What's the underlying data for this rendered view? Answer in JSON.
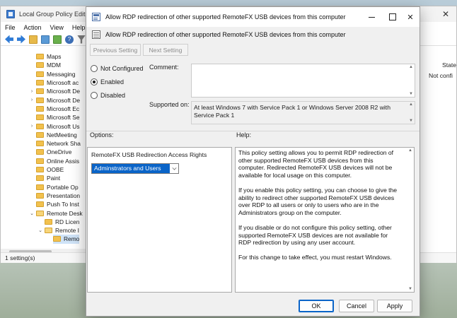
{
  "background_window": {
    "title": "Local Group Policy Editor",
    "menu": [
      "File",
      "Action",
      "View",
      "Help"
    ],
    "tree": [
      {
        "label": "Maps",
        "indent": 2
      },
      {
        "label": "MDM",
        "indent": 2
      },
      {
        "label": "Messaging",
        "indent": 2
      },
      {
        "label": "Microsoft ac",
        "indent": 2
      },
      {
        "label": "Microsoft De",
        "indent": 2,
        "chev": "›"
      },
      {
        "label": "Microsoft De",
        "indent": 2,
        "chev": "›"
      },
      {
        "label": "Microsoft Ec",
        "indent": 2
      },
      {
        "label": "Microsoft Se",
        "indent": 2
      },
      {
        "label": "Microsoft Us",
        "indent": 2,
        "chev": "›"
      },
      {
        "label": "NetMeeting",
        "indent": 2
      },
      {
        "label": "Network Sha",
        "indent": 2
      },
      {
        "label": "OneDrive",
        "indent": 2
      },
      {
        "label": "Online Assis",
        "indent": 2
      },
      {
        "label": "OOBE",
        "indent": 2
      },
      {
        "label": "Paint",
        "indent": 2
      },
      {
        "label": "Portable Op",
        "indent": 2
      },
      {
        "label": "Presentation",
        "indent": 2
      },
      {
        "label": "Push To Inst",
        "indent": 2
      },
      {
        "label": "Remote Desk",
        "indent": 2,
        "chev": "⌄"
      },
      {
        "label": "RD Licen",
        "indent": 3
      },
      {
        "label": "Remote I",
        "indent": 3,
        "chev": "⌄"
      },
      {
        "label": "Remo",
        "indent": 4,
        "selected": true
      }
    ],
    "column_header": "State",
    "column_value": "Not confi",
    "status": "1 setting(s)"
  },
  "dialog": {
    "title": "Allow RDP redirection of other supported RemoteFX USB devices from this computer",
    "header": "Allow RDP redirection of other supported RemoteFX USB devices from this computer",
    "previous_setting": "Previous Setting",
    "next_setting": "Next Setting",
    "radios": {
      "not_configured": "Not Configured",
      "enabled": "Enabled",
      "disabled": "Disabled"
    },
    "selected_option": "Enabled",
    "comment_label": "Comment:",
    "comment_value": "",
    "supported_label": "Supported on:",
    "supported_value": "At least Windows 7 with Service Pack 1 or Windows Server 2008 R2 with Service Pack 1",
    "options_label": "Options:",
    "help_label": "Help:",
    "option_title": "RemoteFX USB Redirection Access Rights",
    "option_select_value": "Adminstrators and Users",
    "help_paragraphs": [
      "This policy setting allows you to permit RDP redirection of other supported RemoteFX USB devices from this computer. Redirected RemoteFX USB devices will not be available for local usage on this computer.",
      "If you enable this policy setting, you can choose to give the ability to redirect other supported RemoteFX USB devices over RDP to all users or only to users who are in the Administrators group on the computer.",
      "If you disable or do not configure this policy setting, other supported RemoteFX USB devices are not available for RDP redirection by using any user account.",
      "For this change to take effect, you must restart Windows."
    ],
    "buttons": {
      "ok": "OK",
      "cancel": "Cancel",
      "apply": "Apply"
    }
  }
}
